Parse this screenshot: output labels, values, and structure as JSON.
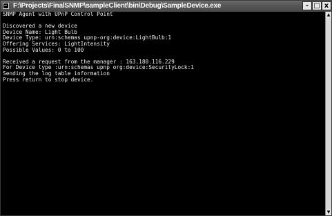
{
  "window": {
    "title": "F:\\Projects\\FinalSNMP\\sampleClient\\bin\\Debug\\SampleDevice.exe",
    "min_label": "-",
    "max_label": "□",
    "close_label": "x"
  },
  "console": {
    "lines": [
      "SNMP Agent with UPnP Control Point",
      "",
      "Discovered a new device",
      "Device Name: Light Bulb",
      "Device Type: urn:schemas upnp-org:device:LightBulb:1",
      "Offering Services: LightIntensity",
      "Possible Values: 0 to 100",
      "",
      "Received a request from the manager : 163.180.116.229",
      "For Device type :urn:schemas upnp org:device:SecurityLock:1",
      "Sending the log table information",
      "Press return to stop device."
    ]
  },
  "scrollbar": {
    "up_arrow": "▲",
    "down_arrow": "▼"
  }
}
